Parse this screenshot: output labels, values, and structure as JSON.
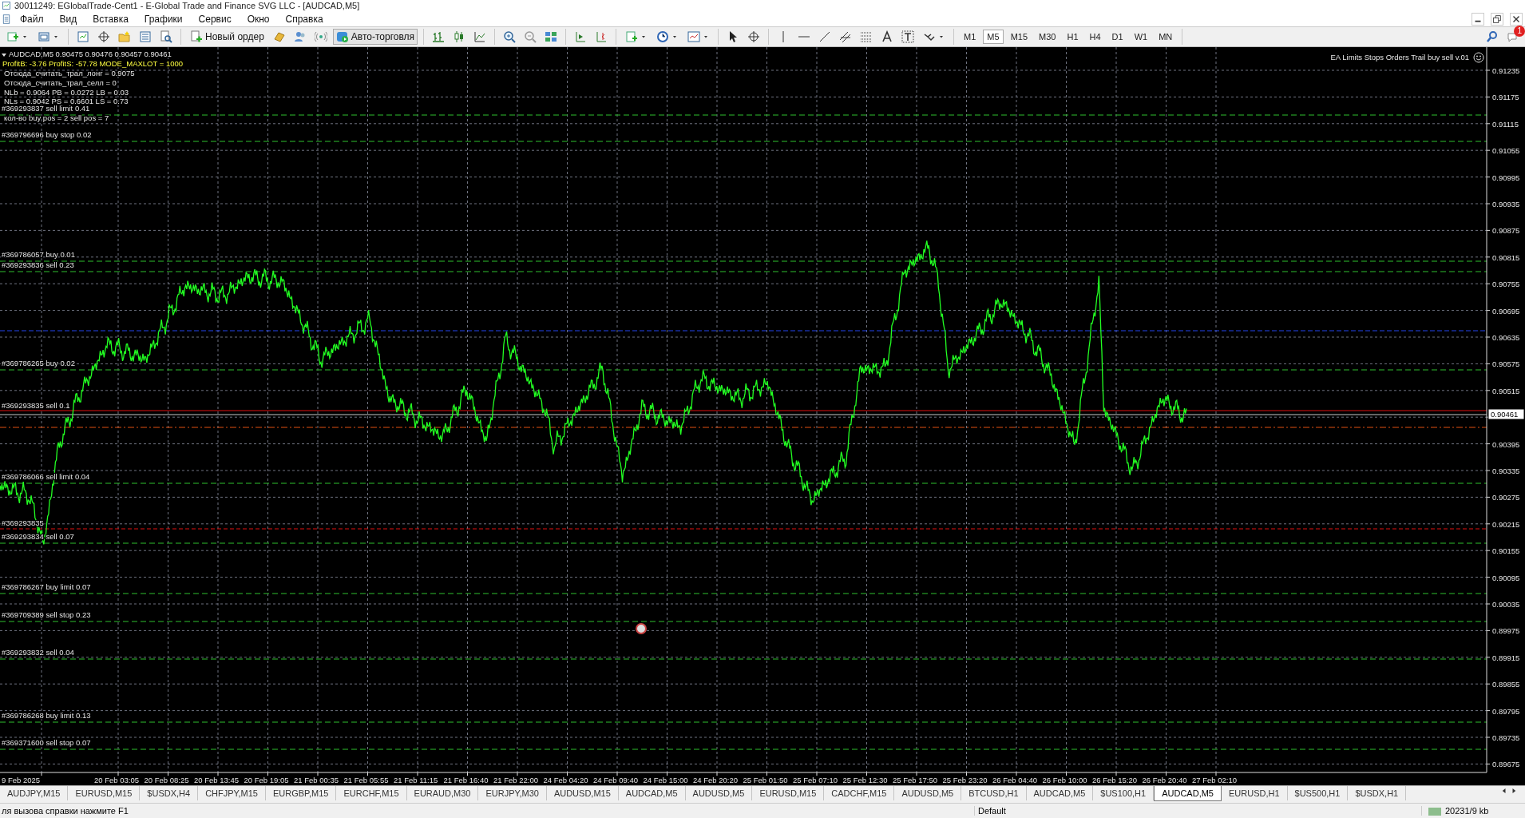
{
  "window": {
    "title": "30011249: EGlobalTrade-Cent1 - E-Global Trade and Finance SVG LLC - [AUDCAD,M5]"
  },
  "menu": [
    "Файл",
    "Вид",
    "Вставка",
    "Графики",
    "Сервис",
    "Окно",
    "Справка"
  ],
  "toolbar": {
    "buttons": [
      {
        "label": "Новый ордер",
        "selected": false
      },
      {
        "label": "Авто-торговля",
        "selected": true
      }
    ],
    "timeframes": [
      {
        "label": "M1",
        "selected": false
      },
      {
        "label": "M5",
        "selected": true
      },
      {
        "label": "M15",
        "selected": false
      },
      {
        "label": "M30",
        "selected": false
      },
      {
        "label": "H1",
        "selected": false
      },
      {
        "label": "H4",
        "selected": false
      },
      {
        "label": "D1",
        "selected": false
      },
      {
        "label": "W1",
        "selected": false
      },
      {
        "label": "MN",
        "selected": false
      }
    ],
    "notifications": "1"
  },
  "chart": {
    "info_lines": [
      "AUDCAD,M5  0.90475 0.90476 0.90457 0.90461",
      "ProfitB: -3.76 ProfitS: -57.78 MODE_MAXLOT = 1000",
      "Отсюда_считать_трал_лонг = 0.9075",
      "Отсюда_считать_трал_селл = 0",
      "NLb = 0.9064 PB = 0.0272 LB = 0.03",
      "NLs = 0.9042 PS = 0.6601 LS = 0.73",
      "кол-во buy pos = 2 sell pos  = 7"
    ],
    "expert_name": "EA Limits Stops Orders Trail buy sell v.01",
    "order_labels": [
      "#369293837 sell limit 0.41",
      "#369796696 buy stop 0.02",
      "#369786057 buy 0.01",
      "#369293836 sell 0.23",
      "#369786265 buy 0.02",
      "#369293835 sell 0.1",
      "#369786066 sell limit 0.04",
      "#369293835",
      "#369293834 sell 0.07",
      "#369786267 buy limit 0.07",
      "#369709389 sell stop 0.23",
      "#369293832 sell 0.04",
      "#369786268 buy limit 0.13",
      "#369371600 sell stop 0.07"
    ],
    "price_axis": [
      "0.91235",
      "0.91175",
      "0.91115",
      "0.91055",
      "0.90995",
      "0.90935",
      "0.90875",
      "0.90815",
      "0.90755",
      "0.90695",
      "0.90635",
      "0.90575",
      "0.90515",
      "0.90395",
      "0.90335",
      "0.90275",
      "0.90215",
      "0.90155",
      "0.90095",
      "0.90035",
      "0.89975",
      "0.89915",
      "0.89855",
      "0.89795",
      "0.89735",
      "0.89675"
    ],
    "current_price": "0.90461",
    "time_axis": [
      "9 Feb 2025",
      "20 Feb 03:05",
      "20 Feb 08:25",
      "20 Feb 13:45",
      "20 Feb 19:05",
      "21 Feb 00:35",
      "21 Feb 05:55",
      "21 Feb 11:15",
      "21 Feb 16:40",
      "21 Feb 22:00",
      "24 Feb 04:20",
      "24 Feb 09:40",
      "24 Feb 15:00",
      "24 Feb 20:20",
      "25 Feb 01:50",
      "25 Feb 07:10",
      "25 Feb 12:30",
      "25 Feb 17:50",
      "25 Feb 23:20",
      "26 Feb 04:40",
      "26 Feb 10:00",
      "26 Feb 15:20",
      "26 Feb 20:40",
      "27 Feb 02:10"
    ]
  },
  "chart_tabs": [
    {
      "label": "AUDJPY,M15",
      "selected": false
    },
    {
      "label": "EURUSD,M15",
      "selected": false
    },
    {
      "label": "$USDX,H4",
      "selected": false
    },
    {
      "label": "CHFJPY,M15",
      "selected": false
    },
    {
      "label": "EURGBP,M15",
      "selected": false
    },
    {
      "label": "EURCHF,M15",
      "selected": false
    },
    {
      "label": "EURAUD,M30",
      "selected": false
    },
    {
      "label": "EURJPY,M30",
      "selected": false
    },
    {
      "label": "AUDUSD,M15",
      "selected": false
    },
    {
      "label": "AUDCAD,M5",
      "selected": false
    },
    {
      "label": "AUDUSD,M5",
      "selected": false
    },
    {
      "label": "EURUSD,M15",
      "selected": false
    },
    {
      "label": "CADCHF,M15",
      "selected": false
    },
    {
      "label": "AUDUSD,M5",
      "selected": false
    },
    {
      "label": "BTCUSD,H1",
      "selected": false
    },
    {
      "label": "AUDCAD,M5",
      "selected": false
    },
    {
      "label": "$US100,H1",
      "selected": false
    },
    {
      "label": "AUDCAD,M5",
      "selected": true
    },
    {
      "label": "EURUSD,H1",
      "selected": false
    },
    {
      "label": "$US500,H1",
      "selected": false
    },
    {
      "label": "$USDX,H1",
      "selected": false
    }
  ],
  "status_bar": {
    "help": "ля вызова справки нажмите F1",
    "profile": "Default",
    "traffic": "20231/9 kb"
  }
}
